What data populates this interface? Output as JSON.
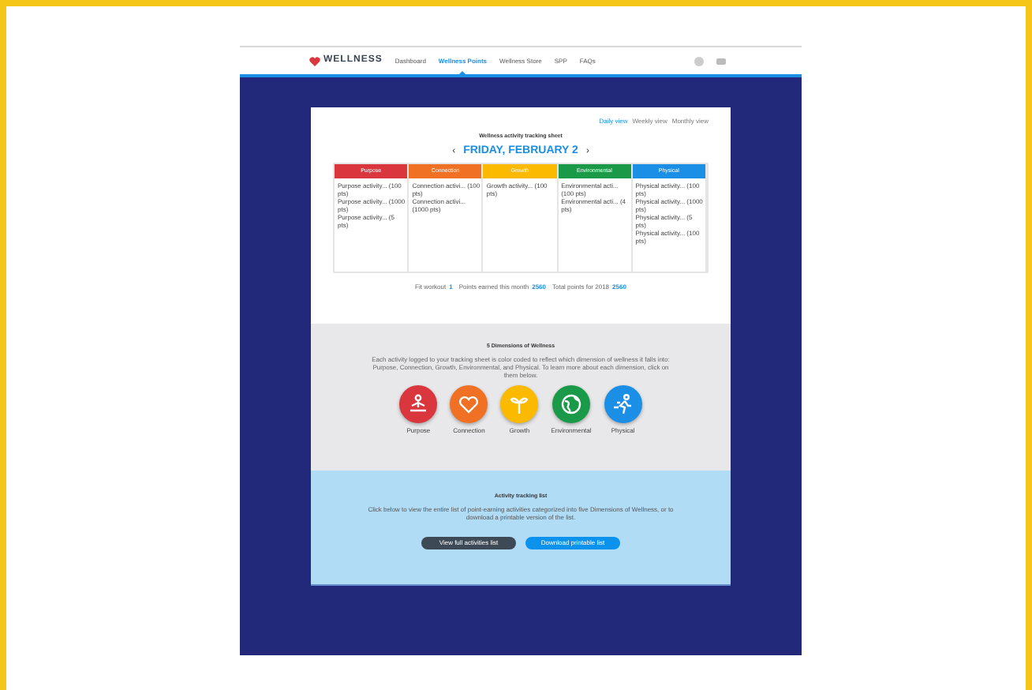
{
  "nav": {
    "logo": "WELLNESS",
    "items": [
      {
        "label": "Dashboard",
        "selected": false
      },
      {
        "label": "Wellness Points",
        "selected": true
      },
      {
        "label": "Wellness Store",
        "selected": false
      },
      {
        "label": "SPP",
        "selected": false
      },
      {
        "label": "FAQs",
        "selected": false
      }
    ]
  },
  "views": [
    {
      "label": "Daily view",
      "selected": true
    },
    {
      "label": "Weekly view",
      "selected": false
    },
    {
      "label": "Monthly view",
      "selected": false
    }
  ],
  "sheet_title": "Wellness activity tracking sheet",
  "date": {
    "prev": "‹",
    "label": "FRIDAY, FEBRUARY 2",
    "next": "›"
  },
  "columns": [
    {
      "name": "Purpose",
      "color": "#d9363e",
      "items": [
        "Purpose activity... (100 pts)",
        "Purpose activity... (1000 pts)",
        "Purpose activity... (5 pts)"
      ]
    },
    {
      "name": "Connection",
      "color": "#f07124",
      "items": [
        "Connection activi... (100 pts)",
        "Connection activi... (1000 pts)"
      ]
    },
    {
      "name": "Growth",
      "color": "#fbb900",
      "items": [
        "Growth activity... (100 pts)"
      ]
    },
    {
      "name": "Environmental",
      "color": "#1a9a48",
      "items": [
        "Environmental acti... (100 pts)",
        "Environmental acti... (4 pts)"
      ]
    },
    {
      "name": "Physical",
      "color": "#1b8ee6",
      "items": [
        "Physical activity... (100 pts)",
        "Physical activity... (1000 pts)",
        "Physical activity... (5 pts)",
        "Physical activity... (100 pts)"
      ]
    }
  ],
  "stats": [
    {
      "label": "Fit workout",
      "value": "1"
    },
    {
      "label": "Points earned this month",
      "value": "2560"
    },
    {
      "label": "Total points for 2018",
      "value": "2560"
    }
  ],
  "dimensions": {
    "title": "5 Dimensions of Wellness",
    "text": "Each activity logged to your tracking sheet is color coded to reflect which dimension of wellness it falls into: Purpose, Connection, Growth, Environmental, and Physical. To learn more about each dimension, click on them below.",
    "items": [
      {
        "label": "Purpose",
        "color": "#d9363e",
        "kind": "meditation"
      },
      {
        "label": "Connection",
        "color": "#f07124",
        "kind": "heart"
      },
      {
        "label": "Growth",
        "color": "#fbb900",
        "kind": "growth"
      },
      {
        "label": "Environmental",
        "color": "#1a9a48",
        "kind": "globe"
      },
      {
        "label": "Physical",
        "color": "#1b8ee6",
        "kind": "runner"
      }
    ]
  },
  "tracking": {
    "title": "Activity tracking list",
    "text": "Click below to view the entire list of point-earning activities categorized into five Dimensions of Wellness, or to download a printable version of the list.",
    "buttons": [
      {
        "label": "View full activities list",
        "kind": "dark"
      },
      {
        "label": "Download printable list",
        "kind": "primary"
      }
    ]
  }
}
